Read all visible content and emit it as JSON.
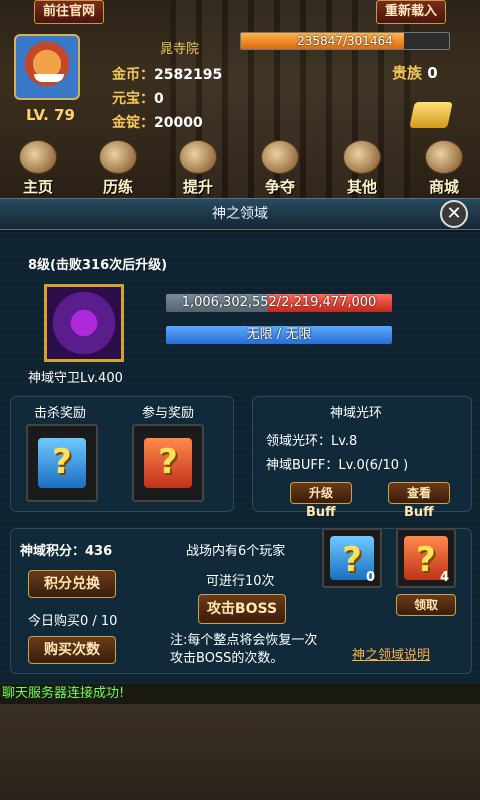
{
  "header": {
    "website_button": "前往官网",
    "reload_button": "重新载入",
    "level": "LV. 79",
    "location": "晁寺院",
    "hp_text": "235847/301464",
    "hp_fraction": 0.782,
    "vip_label": "贵族",
    "vip_level": "0",
    "stats": [
      {
        "key": "金币：",
        "value": "2582195"
      },
      {
        "key": "元宝：",
        "value": "0"
      },
      {
        "key": "金锭：",
        "value": "20000"
      }
    ]
  },
  "nav": [
    {
      "label": "主页",
      "icon": "temple-icon"
    },
    {
      "label": "历练",
      "icon": "scroll-icon"
    },
    {
      "label": "提升",
      "icon": "mask-icon"
    },
    {
      "label": "争夺",
      "icon": "warrior-icon"
    },
    {
      "label": "其他",
      "icon": "letter-icon"
    },
    {
      "label": "商城",
      "icon": "shop-icon"
    }
  ],
  "dialog": {
    "title": "神之领域",
    "close": "✕"
  },
  "boss": {
    "level_text": "8级(击败316次后升级)",
    "guard_name": "神域守卫Lv.400",
    "hp_text": "1,006,302,552/2,219,477,000",
    "hp_fraction": 0.453,
    "limit_text": "无限 / 无限"
  },
  "rewards": {
    "kill_label": "击杀奖励",
    "join_label": "参与奖励"
  },
  "aura": {
    "title": "神域光环",
    "aura_text": "领域光环：Lv.8",
    "buff_text": "神域BUFF：Lv.0(6/10 )",
    "upgrade_btn": "升级",
    "upgrade_sub": "Buff",
    "view_btn": "查看",
    "view_sub": "Buff"
  },
  "score": {
    "points_text": "神域积分：436",
    "exchange_btn": "积分兑换",
    "today_buy": "今日购买0 / 10",
    "buy_btn": "购买次数",
    "players_text": "战场内有6个玩家",
    "attempts_text": "可进行10次",
    "attack_btn": "攻击BOSS",
    "note": "注:每个整点将会恢复一次攻击BOSS的次数。",
    "blue_count": "0",
    "red_count": "4",
    "claim_btn": "领取",
    "help_link": "神之领域说明"
  },
  "chat": "聊天服务器连接成功!"
}
